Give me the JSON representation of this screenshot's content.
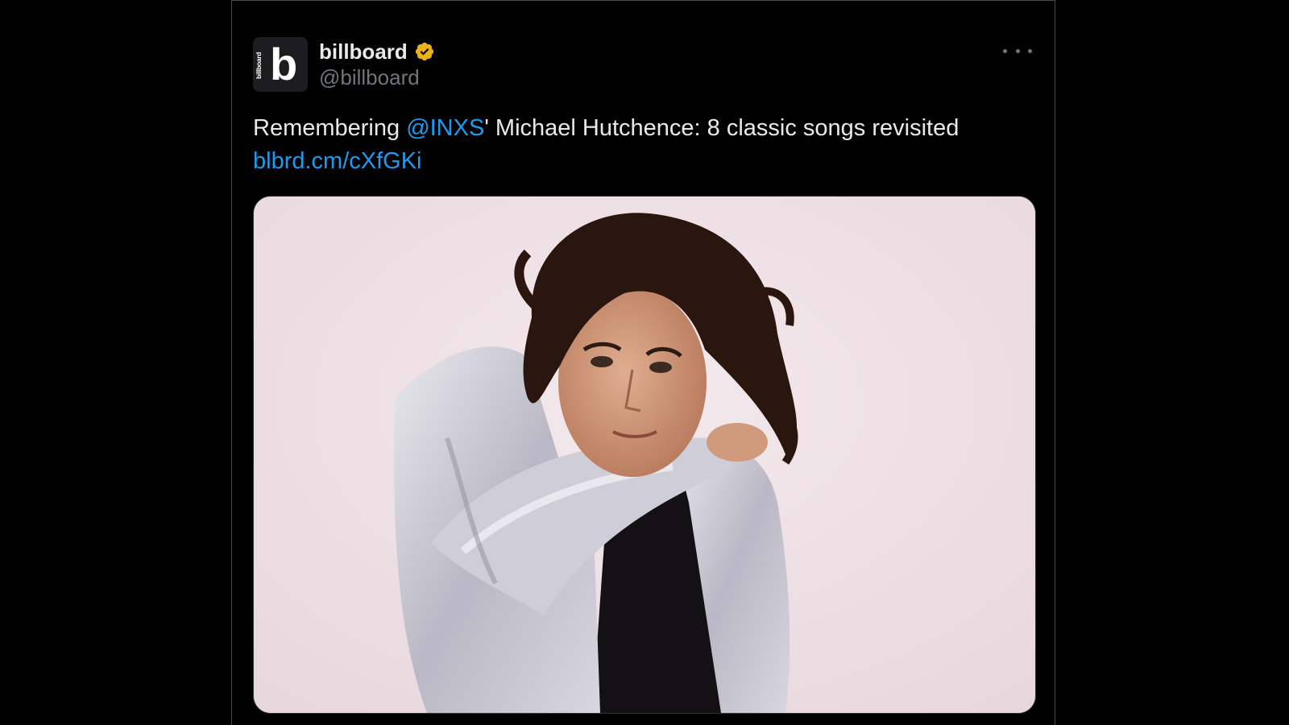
{
  "account": {
    "display_name": "billboard",
    "handle": "@billboard",
    "avatar_letter": "b",
    "avatar_text": "billboard",
    "verified_color": "#e8b418"
  },
  "tweet": {
    "text_before": "Remembering ",
    "mention": "@INXS",
    "text_after": "' Michael Hutchence: 8 classic songs revisited",
    "link": "blbrd.cm/cXfGKi"
  },
  "colors": {
    "background": "#000000",
    "text": "#e7e9ea",
    "muted": "#71767b",
    "accent": "#1d9bf0",
    "photo_background": "#ecdfe3"
  },
  "icons": {
    "more": "more-dots-icon",
    "verified": "verified-badge-icon"
  }
}
